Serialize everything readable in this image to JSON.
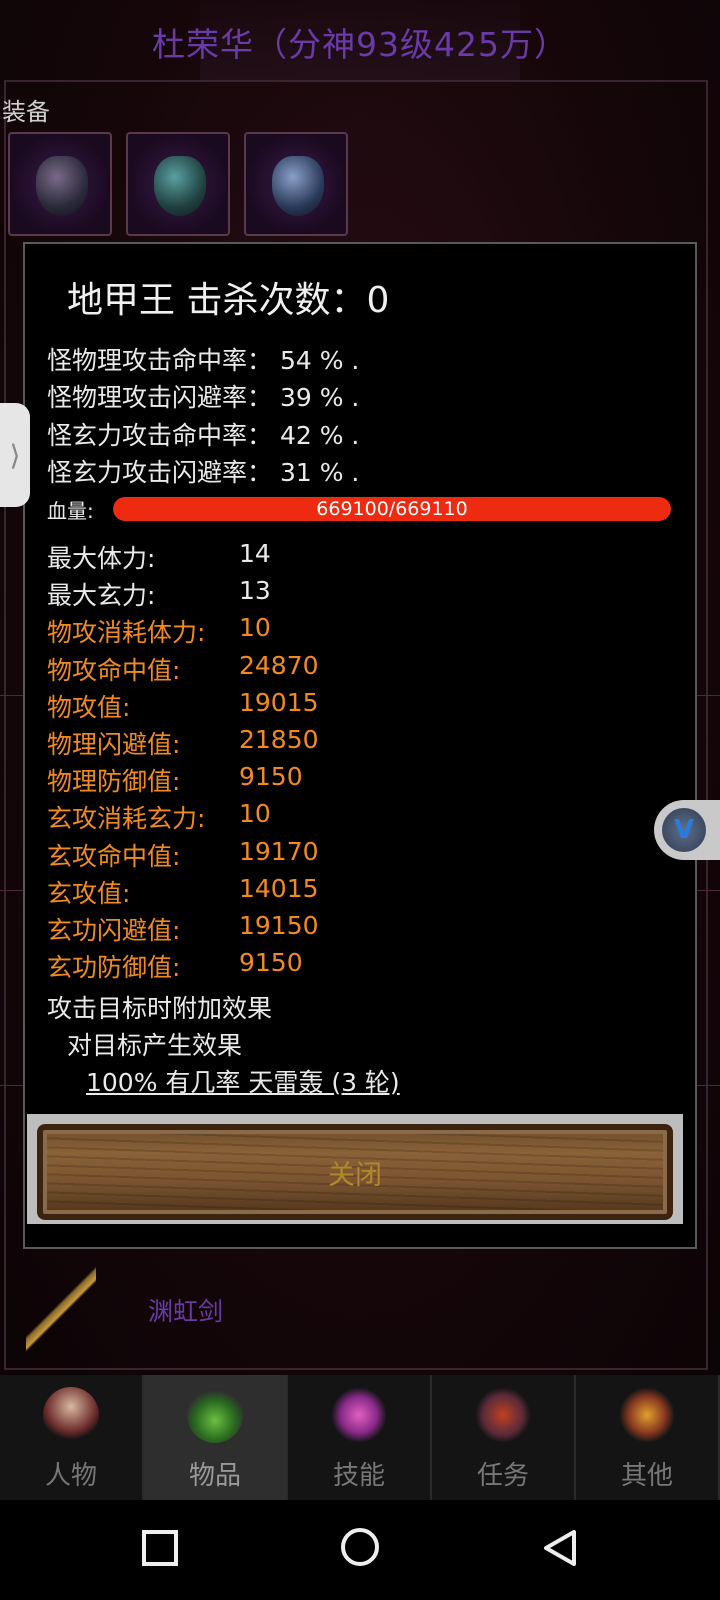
{
  "header": {
    "title": "杜荣华（分神93级425万）"
  },
  "equipment": {
    "label": "装备"
  },
  "modal": {
    "title": "地甲王  击杀次数：0",
    "rates": [
      "怪物理攻击命中率：  54 % .",
      "怪物理攻击闪避率：  39 % .",
      "怪玄力攻击命中率：  42 % .",
      "怪玄力攻击闪避率：  31 % ."
    ],
    "hp": {
      "label": "血量:",
      "text": "669100/669110",
      "fill_fraction": 0.99998,
      "color": "#ee2a10"
    },
    "stats": [
      {
        "key": "最大体力:",
        "value": "14",
        "color": "white"
      },
      {
        "key": "最大玄力:",
        "value": "13",
        "color": "white"
      },
      {
        "key": "物攻消耗体力:",
        "value": "10",
        "color": "orange"
      },
      {
        "key": "物攻命中值:",
        "value": "24870",
        "color": "orange"
      },
      {
        "key": "物攻值:",
        "value": "19015",
        "color": "orange"
      },
      {
        "key": "物理闪避值:",
        "value": "21850",
        "color": "orange"
      },
      {
        "key": "物理防御值:",
        "value": "9150",
        "color": "orange"
      },
      {
        "key": "玄攻消耗玄力:",
        "value": "10",
        "color": "orange"
      },
      {
        "key": "玄攻命中值:",
        "value": "19170",
        "color": "orange"
      },
      {
        "key": "玄攻值:",
        "value": "14015",
        "color": "orange"
      },
      {
        "key": "玄功闪避值:",
        "value": "19150",
        "color": "orange"
      },
      {
        "key": "玄功防御值:",
        "value": "9150",
        "color": "orange"
      }
    ],
    "effects": {
      "heading": "攻击目标时附加效果",
      "sub": "对目标产生效果",
      "detail": "100% 有几率 天雷轰 (3 轮)"
    },
    "close_label": "关闭"
  },
  "background_item": {
    "name": "渊虹剑"
  },
  "bottom_nav": [
    {
      "label": "人物",
      "icon": "character-icon",
      "active": false
    },
    {
      "label": "物品",
      "icon": "potion-icon",
      "active": true
    },
    {
      "label": "技能",
      "icon": "skill-icon",
      "active": false
    },
    {
      "label": "任务",
      "icon": "quest-icon",
      "active": false
    },
    {
      "label": "其他",
      "icon": "other-icon",
      "active": false
    }
  ],
  "colors": {
    "orange": "#f28a1e",
    "white": "#eaeaea",
    "title_purple": "#6a3aa8"
  }
}
